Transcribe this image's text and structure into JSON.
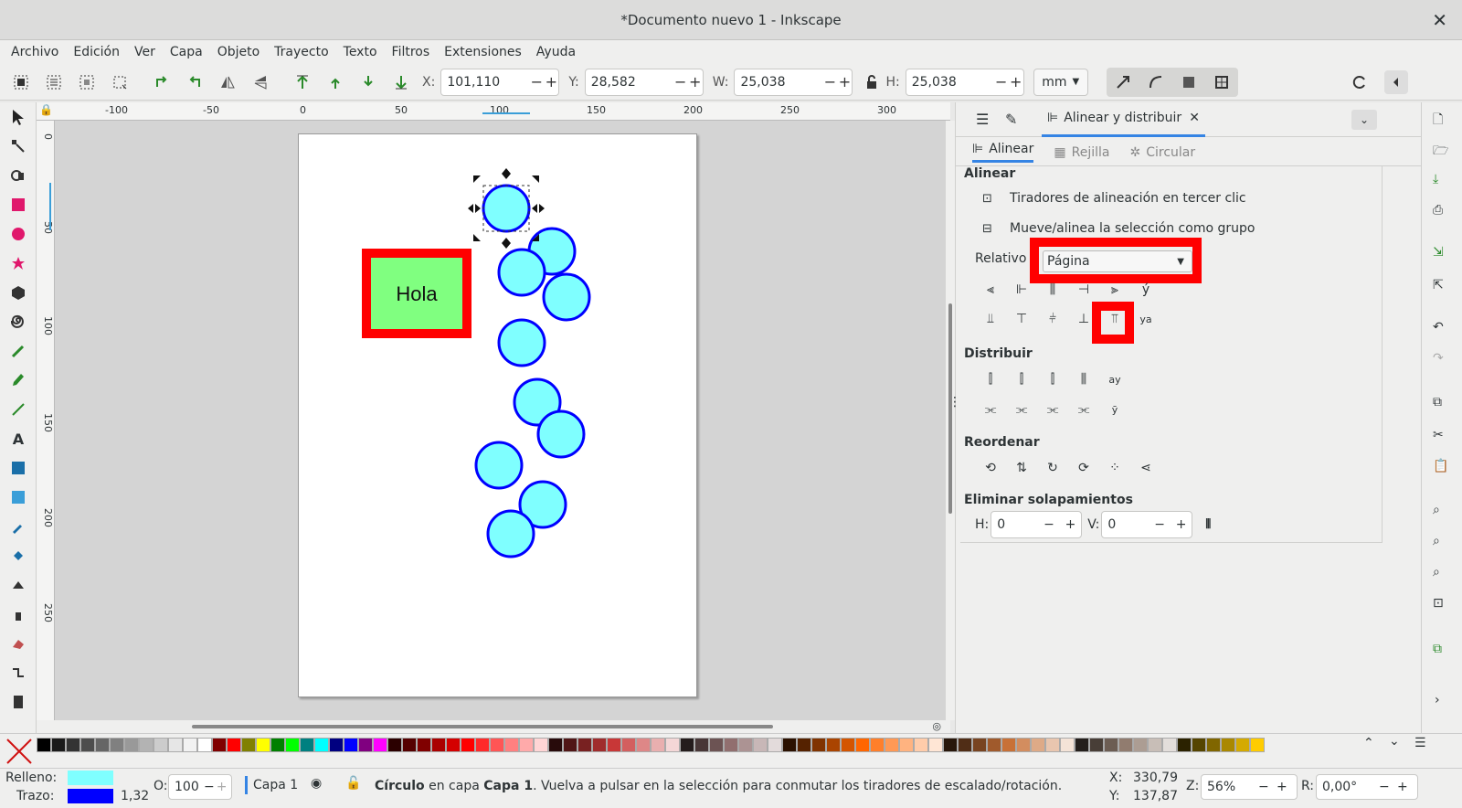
{
  "window": {
    "title": "*Documento nuevo 1 - Inkscape",
    "close": "✕"
  },
  "menu": [
    "Archivo",
    "Edición",
    "Ver",
    "Capa",
    "Objeto",
    "Trayecto",
    "Texto",
    "Filtros",
    "Extensiones",
    "Ayuda"
  ],
  "toolbar": {
    "x_label": "X:",
    "x_value": "101,110",
    "y_label": "Y:",
    "y_value": "28,582",
    "w_label": "W:",
    "w_value": "25,038",
    "h_label": "H:",
    "h_value": "25,038",
    "unit": "mm"
  },
  "ruler_h": [
    "-100",
    "-50",
    "0",
    "50",
    "100",
    "150",
    "200",
    "250",
    "300"
  ],
  "ruler_v": [
    "0",
    "50",
    "100",
    "150",
    "200",
    "250"
  ],
  "canvas": {
    "text_box": "Hola"
  },
  "panel": {
    "tabs": {
      "active": "Alinear y distribuir"
    },
    "subtabs": [
      "Alinear",
      "Rejilla",
      "Circular"
    ],
    "align_section": "Alinear",
    "opt1": "Tiradores de alineación en tercer clic",
    "opt2": "Mueve/alinea la selección como grupo",
    "relative_label": "Relativo a",
    "relative_value": "Página",
    "distribute_section": "Distribuir",
    "reorder_section": "Reordenar",
    "overlap_section": "Eliminar solapamientos",
    "h_label": "H:",
    "h_value": "0",
    "v_label": "V:",
    "v_value": "0"
  },
  "status": {
    "fill_label": "Relleno:",
    "stroke_label": "Trazo:",
    "stroke_width": "1,32",
    "opacity_label": "O:",
    "opacity_value": "100",
    "layer": "Capa 1",
    "msg_bold": "Círculo",
    "msg_mid": " en capa ",
    "msg_layer": "Capa 1",
    "msg_tail": ". Vuelva a pulsar en la selección para conmutar los tiradores de escalado/rotación.",
    "x_label": "X:",
    "x_value": "330,79",
    "y_label": "Y:",
    "y_value": "137,87",
    "zoom_label": "Z:",
    "zoom_value": "56%",
    "rot_label": "R:",
    "rot_value": "0,00°"
  },
  "colors": {
    "fill": "#7fffff",
    "stroke": "#0000ff",
    "highlight": "#ff0000",
    "rect_fill": "#80ff80"
  }
}
